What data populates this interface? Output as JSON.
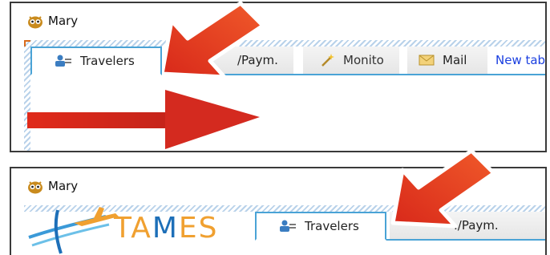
{
  "top": {
    "window_title": "Mary",
    "tabs": [
      {
        "label": "Travelers",
        "icon": "traveler-icon",
        "active": true
      },
      {
        "label": "/Paym.",
        "icon": "payment-icon",
        "active": false
      },
      {
        "label": "Monito",
        "icon": "wand-icon",
        "active": false
      },
      {
        "label": "Mail",
        "icon": "mail-icon",
        "active": false
      },
      {
        "label": "New tab",
        "icon": "",
        "active": false
      }
    ]
  },
  "bottom": {
    "window_title": "Mary",
    "logo": {
      "text_pre": "TA",
      "text_m": "M",
      "text_post": "ES"
    },
    "tabs": [
      {
        "label": "Travelers",
        "icon": "traveler-icon",
        "active": true
      },
      {
        "label": "./Paym.",
        "icon": "payment-icon",
        "active": false
      }
    ]
  },
  "colors": {
    "accent_blue": "#4aa3d6",
    "new_tab_link": "#1a3fe0",
    "annotation_red": "#e8291c",
    "logo_orange": "#f0a030",
    "logo_blue": "#1d6fb8"
  }
}
